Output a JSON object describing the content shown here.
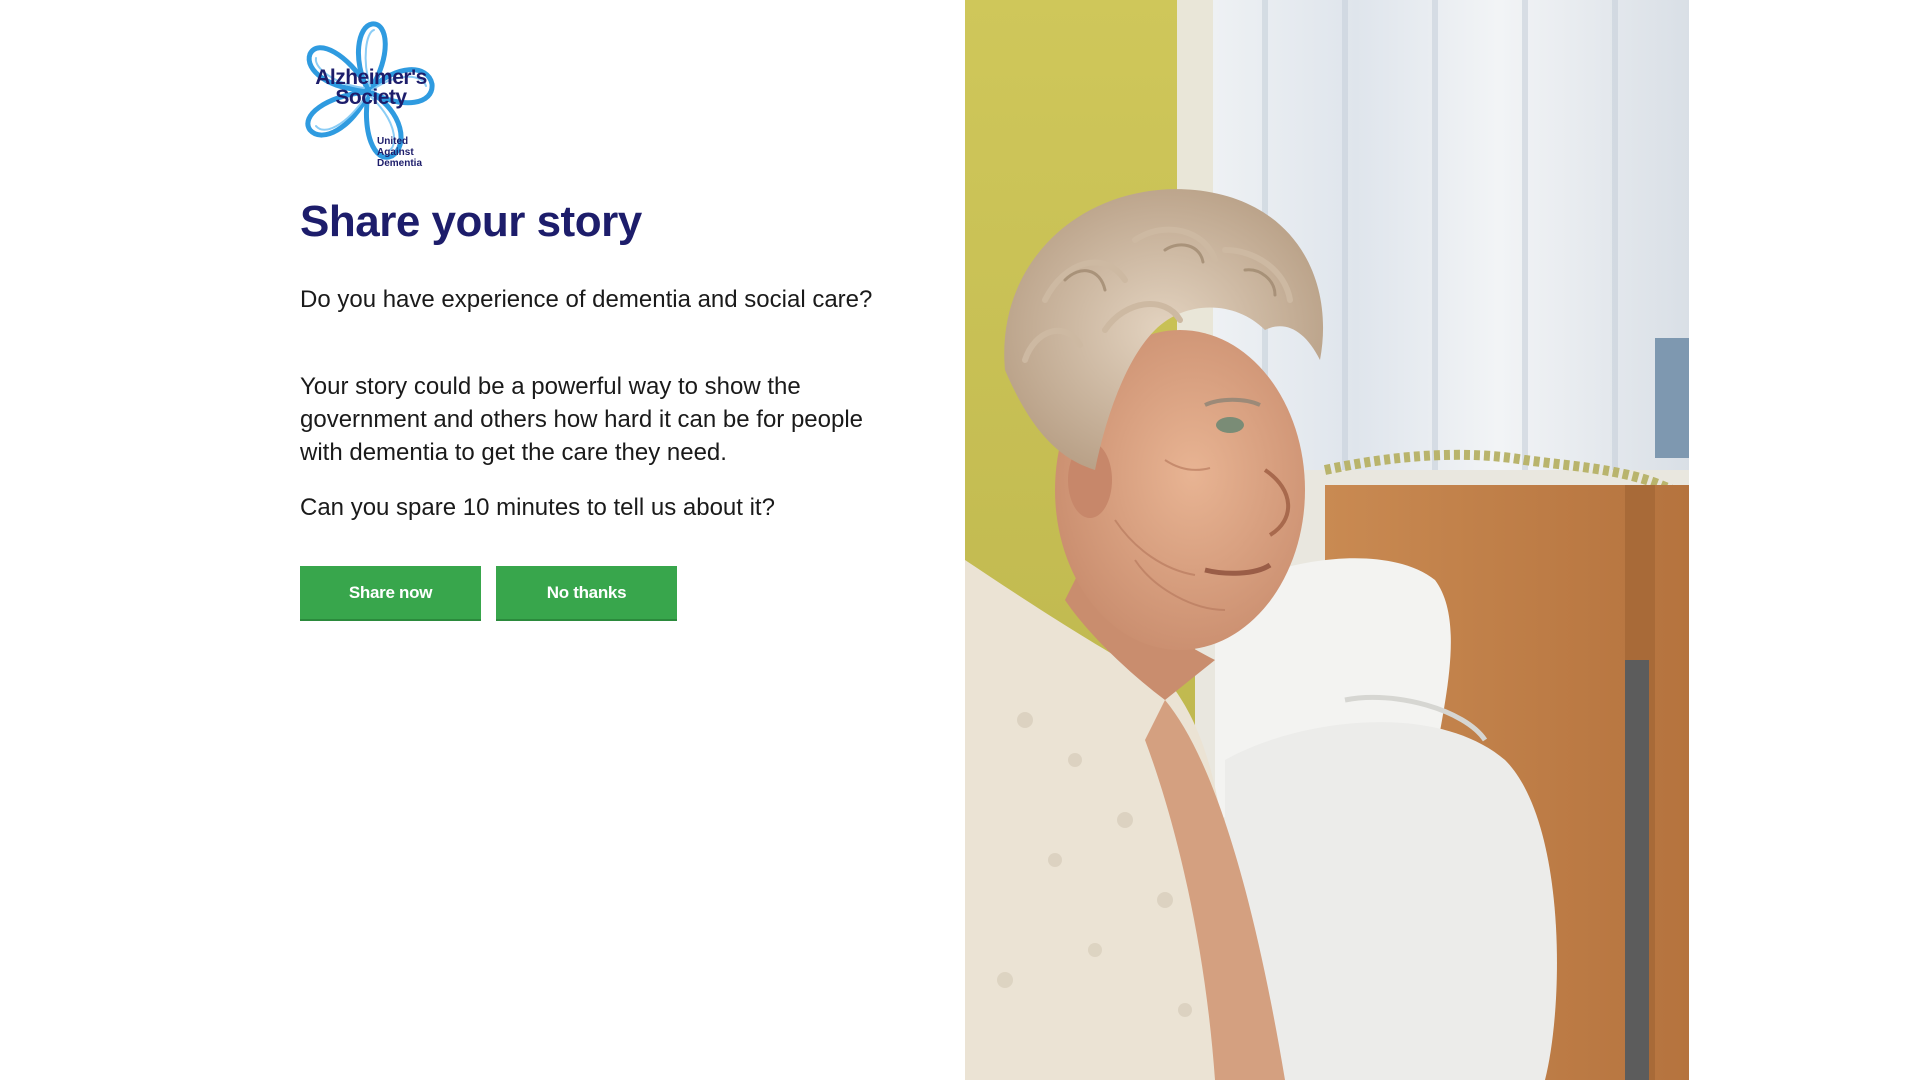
{
  "logo": {
    "name_line_1": "Alzheimer's",
    "name_line_2": "Society",
    "tagline_1": "United",
    "tagline_2": "Against",
    "tagline_3": "Dementia",
    "icon": "forget-me-not-flower-icon",
    "colors": {
      "petal": "#2f9be0",
      "text": "#1d1d6b"
    }
  },
  "content": {
    "title": "Share your story",
    "paragraph_1": "Do you have experience of dementia and social care?",
    "paragraph_2": "Your story could be a powerful way to show the government and others how hard it can be for people with dementia to get the care they need.",
    "paragraph_3": "Can you spare 10 minutes to tell us about it?"
  },
  "buttons": {
    "share_label": "Share now",
    "decline_label": "No thanks",
    "color": "#38a64c"
  },
  "photo": {
    "subject": "elderly-woman-portrait-image"
  }
}
